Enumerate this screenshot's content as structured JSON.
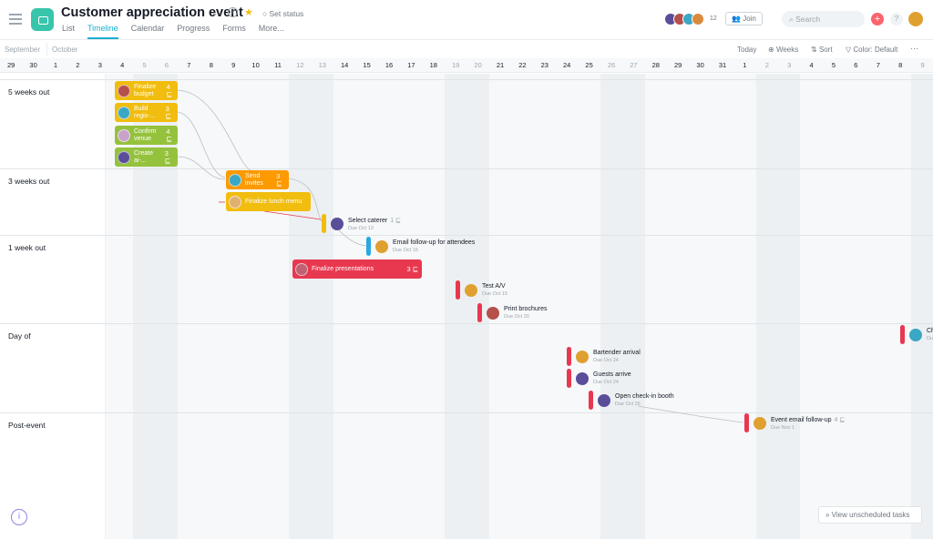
{
  "project": {
    "title": "Customer appreciation event",
    "set_status": "Set status",
    "tabs": [
      "List",
      "Timeline",
      "Calendar",
      "Progress",
      "Forms",
      "More..."
    ],
    "active_tab": "Timeline",
    "member_count": "12",
    "join": "Join",
    "search_placeholder": "Search",
    "help": "?"
  },
  "toolbar": {
    "today": "Today",
    "weeks": "Weeks",
    "sort": "Sort",
    "color": "Color: Default",
    "more": "···"
  },
  "months": [
    "September",
    "October"
  ],
  "days": [
    "29",
    "30",
    "1",
    "2",
    "3",
    "4",
    "5",
    "6",
    "7",
    "8",
    "9",
    "10",
    "11",
    "12",
    "13",
    "14",
    "15",
    "16",
    "17",
    "18",
    "19",
    "20",
    "21",
    "22",
    "23",
    "24",
    "25",
    "26",
    "27",
    "28",
    "29",
    "30",
    "31",
    "1",
    "2",
    "3",
    "4",
    "5",
    "6",
    "7",
    "8",
    "9"
  ],
  "weekend_days": [
    6,
    7,
    13,
    14,
    20,
    21,
    27,
    28,
    34,
    35,
    41
  ],
  "sections": [
    "5 weeks out",
    "3 weeks out",
    "1 week out",
    "Day of",
    "Post-event"
  ],
  "colors": {
    "yellow": "#f1bd0e",
    "green": "#95c23d",
    "orange": "#fd9a00",
    "red": "#e8384f",
    "blue": "#2aa8e0",
    "accent": "#1aafd0"
  },
  "tasks": [
    {
      "label": "Finalize budget",
      "count": "4",
      "color": "yellow"
    },
    {
      "label": "Build regis-...",
      "count": "3",
      "color": "yellow"
    },
    {
      "label": "Confirm venue",
      "count": "4",
      "color": "green"
    },
    {
      "label": "Create ai-...",
      "count": "3",
      "color": "green"
    },
    {
      "label": "Send invites",
      "count": "3",
      "color": "orange"
    },
    {
      "label": "Finalize lunch menu",
      "count": "",
      "color": "yellow"
    },
    {
      "label": "Finalize presentations",
      "count": "3",
      "color": "red"
    }
  ],
  "milestones": [
    {
      "label": "Select caterer",
      "count": "1",
      "due": "Due Oct 13",
      "color": "yellow"
    },
    {
      "label": "Email follow-up for attendees",
      "count": "",
      "due": "Due Oct 15",
      "color": "blue"
    },
    {
      "label": "Test A/V",
      "count": "",
      "due": "Due Oct 19",
      "color": "red"
    },
    {
      "label": "Print brochures",
      "count": "",
      "due": "Due Oct 20",
      "color": "red"
    },
    {
      "label": "Bartender arrival",
      "count": "",
      "due": "Due Oct 24",
      "color": "red"
    },
    {
      "label": "Guests arrive",
      "count": "",
      "due": "Due Oct 24",
      "color": "red"
    },
    {
      "label": "Open check-in booth",
      "count": "",
      "due": "Due Oct 26",
      "color": "red"
    },
    {
      "label": "Event email follow-up",
      "count": "4",
      "due": "Due Nov 1",
      "color": "red"
    },
    {
      "label": "Che",
      "count": "",
      "due": "Due",
      "color": "red"
    }
  ],
  "unscheduled": "View unscheduled tasks"
}
